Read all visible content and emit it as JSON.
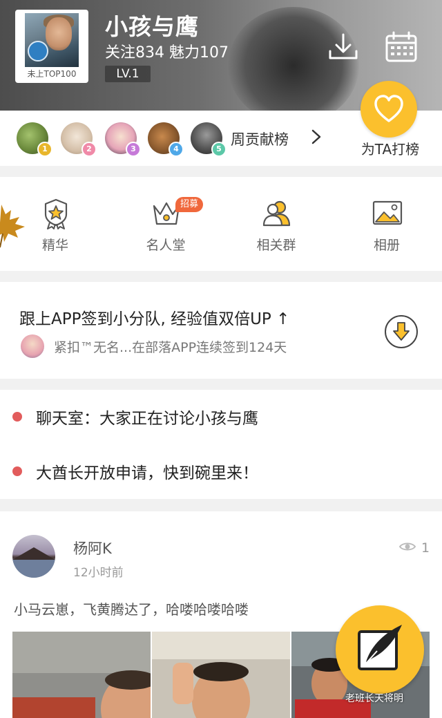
{
  "header": {
    "title": "小孩与鹰",
    "stats": "关注834 魅力107",
    "level": "LV.1",
    "avatar_caption": "未上TOP100"
  },
  "rank": {
    "label": "周贡献榜",
    "fans": [
      {
        "rank": "1",
        "color": "#e8b62c"
      },
      {
        "rank": "2",
        "color": "#f08aa8"
      },
      {
        "rank": "3",
        "color": "#c67ad8"
      },
      {
        "rank": "4",
        "color": "#4fa8e8"
      },
      {
        "rank": "5",
        "color": "#5cc8a8"
      }
    ],
    "boost_label": "为TA打榜"
  },
  "menu": {
    "items": [
      {
        "label": "精华",
        "icon": "ribbon-star-icon"
      },
      {
        "label": "名人堂",
        "icon": "crown-icon"
      },
      {
        "label": "相关群",
        "icon": "group-icon"
      },
      {
        "label": "相册",
        "icon": "photo-album-icon"
      }
    ],
    "hiring_badge": "招募"
  },
  "checkin": {
    "title": "跟上APP签到小分队, 经验值双倍UP ↑",
    "subtitle": "紧扣™无名...在部落APP连续签到124天"
  },
  "notices": [
    "聊天室：大家正在讨论小孩与鹰",
    "大酋长开放申请，快到碗里来！"
  ],
  "post": {
    "author": "杨阿K",
    "time": "12小时前",
    "views": "1",
    "text": "小马云崽，飞黄腾达了，哈喽哈喽哈喽"
  },
  "watermark": "老班长天将明",
  "colors": {
    "accent": "#fbc02d",
    "notice_dot": "#e25c5c",
    "hiring_badge": "#f0683c"
  }
}
